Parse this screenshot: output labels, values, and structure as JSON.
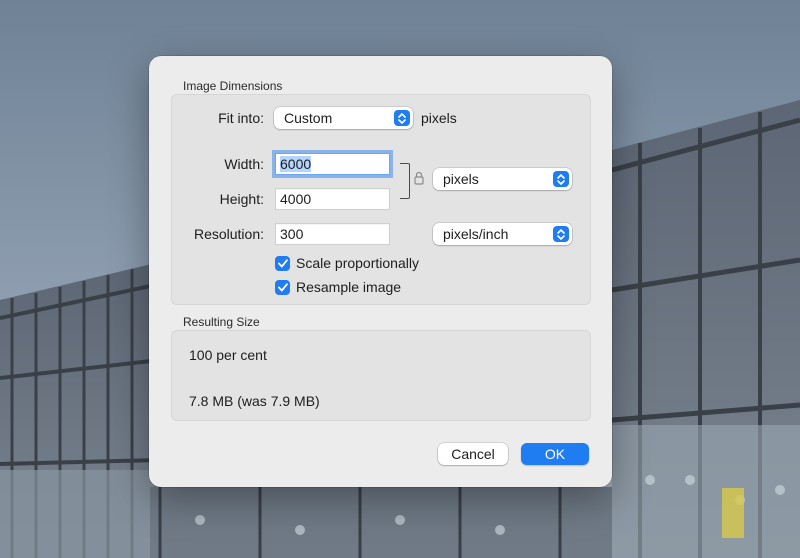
{
  "dialog": {
    "image_dimensions": {
      "title": "Image Dimensions",
      "fit_into": {
        "label": "Fit into:",
        "value": "Custom",
        "unit": "pixels"
      },
      "width": {
        "label": "Width:",
        "value": "6000"
      },
      "height": {
        "label": "Height:",
        "value": "4000"
      },
      "dimension_unit": {
        "value": "pixels"
      },
      "resolution": {
        "label": "Resolution:",
        "value": "300",
        "unit": "pixels/inch"
      },
      "scale_proportionally": {
        "label": "Scale proportionally",
        "checked": true
      },
      "resample_image": {
        "label": "Resample image",
        "checked": true
      }
    },
    "resulting_size": {
      "title": "Resulting Size",
      "percent": "100 per cent",
      "file_size": "7.8 MB (was 7.9 MB)"
    },
    "buttons": {
      "cancel": "Cancel",
      "ok": "OK"
    }
  },
  "colors": {
    "accent": "#1f7cf1",
    "dialog_bg": "#ececec",
    "group_bg": "#e3e3e3"
  },
  "icons": [
    "lock-icon",
    "chevron-updown-icon",
    "checkmark-icon"
  ]
}
